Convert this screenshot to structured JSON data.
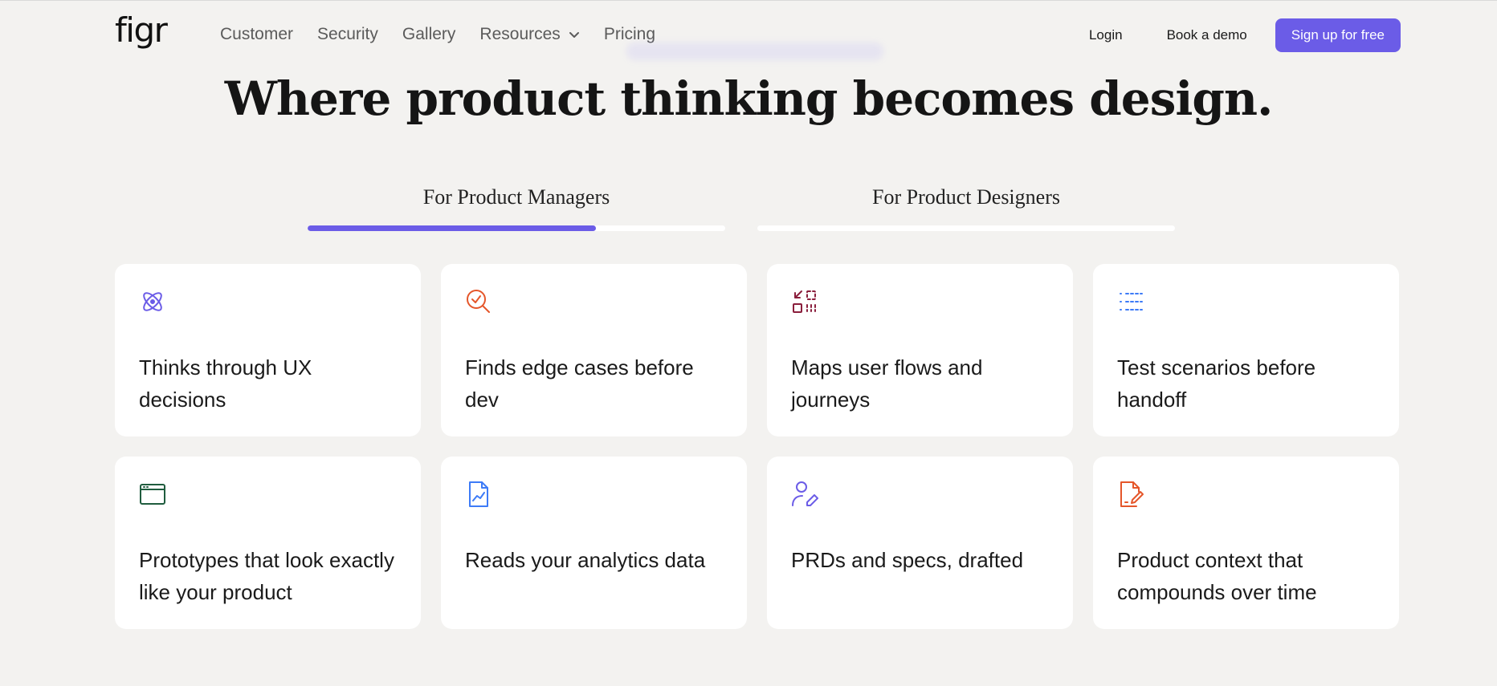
{
  "nav": {
    "logo": "figr",
    "links": [
      "Customer",
      "Security",
      "Gallery",
      "Resources",
      "Pricing"
    ],
    "login": "Login",
    "demo": "Book a demo",
    "signup": "Sign up for free"
  },
  "hero": {
    "headline": "Where product thinking becomes design."
  },
  "tabs": [
    {
      "label": "For Product Managers",
      "progress": 0.69,
      "active": true
    },
    {
      "label": "For Product Designers",
      "progress": 0,
      "active": false
    }
  ],
  "colors": {
    "accent": "#6b5ce7",
    "background": "#f3f2f0"
  },
  "cards": [
    {
      "icon": "atom-icon",
      "text": "Thinks through UX decisions",
      "color": "#6b5ce7"
    },
    {
      "icon": "search-check-icon",
      "text": "Finds edge cases before dev",
      "color": "#e5562a"
    },
    {
      "icon": "flow-icon",
      "text": "Maps user flows and journeys",
      "color": "#8a1e3c"
    },
    {
      "icon": "list-icon",
      "text": "Test scenarios before handoff",
      "color": "#3d7bf7"
    },
    {
      "icon": "browser-window-icon",
      "text": "Prototypes that look exactly like your product",
      "color": "#1f5c3e"
    },
    {
      "icon": "chart-file-icon",
      "text": "Reads your analytics data",
      "color": "#3d7bf7"
    },
    {
      "icon": "user-pen-icon",
      "text": "PRDs and specs, drafted",
      "color": "#6b5ce7"
    },
    {
      "icon": "file-signature-icon",
      "text": "Product context that compounds over time",
      "color": "#e5562a"
    }
  ]
}
